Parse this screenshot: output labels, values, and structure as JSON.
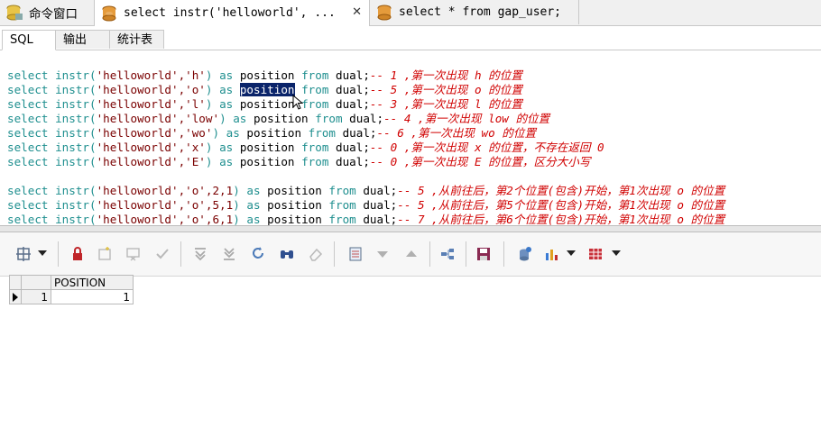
{
  "doc_tabs": [
    {
      "label": "命令窗口"
    },
    {
      "label": "select instr('helloworld', ..."
    },
    {
      "label": "select * from gap_user;"
    }
  ],
  "sub_tabs": [
    {
      "label": "SQL"
    },
    {
      "label": "输出"
    },
    {
      "label": "统计表"
    }
  ],
  "code_lines": [
    {
      "fn": "select instr(",
      "str": "'helloworld','h'",
      "as": ") as ",
      "col": "position",
      "from": " from ",
      "tbl": "dual;",
      "cmt": "-- 1 ,第一次出现 h 的位置"
    },
    {
      "fn": "select instr(",
      "str": "'helloworld','o'",
      "as": ") as ",
      "col": "position",
      "from": " from ",
      "tbl": "dual;",
      "cmt": "-- 5 ,第一次出现 o 的位置"
    },
    {
      "fn": "select instr(",
      "str": "'helloworld','l'",
      "as": ") as ",
      "col": "position",
      "from": " from ",
      "tbl": "dual;",
      "cmt": "-- 3 ,第一次出现 l 的位置"
    },
    {
      "fn": "select instr(",
      "str": "'helloworld','low'",
      "as": ") as ",
      "col": "position",
      "from": " from ",
      "tbl": "dual;",
      "cmt": "-- 4 ,第一次出现 low 的位置"
    },
    {
      "fn": "select instr(",
      "str": "'helloworld','wo'",
      "as": ") as ",
      "col": "position",
      "from": " from ",
      "tbl": "dual;",
      "cmt": "-- 6 ,第一次出现 wo 的位置"
    },
    {
      "fn": "select instr(",
      "str": "'helloworld','x'",
      "as": ") as ",
      "col": "position",
      "from": " from ",
      "tbl": "dual;",
      "cmt": "-- 0 ,第一次出现 x 的位置，不存在返回 0"
    },
    {
      "fn": "select instr(",
      "str": "'helloworld','E'",
      "as": ") as ",
      "col": "position",
      "from": " from ",
      "tbl": "dual;",
      "cmt": "-- 0 ,第一次出现 E 的位置，区分大小写"
    },
    {
      "blank": true
    },
    {
      "fn": "select instr(",
      "str": "'helloworld','o',2,1",
      "as": ") as ",
      "col": "position",
      "from": " from ",
      "tbl": "dual;",
      "cmt": "-- 5 ,从前往后，第2个位置(包含)开始，第1次出现 o 的位置"
    },
    {
      "fn": "select instr(",
      "str": "'helloworld','o',5,1",
      "as": ") as ",
      "col": "position",
      "from": " from ",
      "tbl": "dual;",
      "cmt": "-- 5 ,从前往后，第5个位置(包含)开始，第1次出现 o 的位置"
    },
    {
      "fn": "select instr(",
      "str": "'helloworld','o',6,1",
      "as": ") as ",
      "col": "position",
      "from": " from ",
      "tbl": "dual;",
      "cmt": "-- 7 ,从前往后，第6个位置(包含)开始，第1次出现 o 的位置"
    }
  ],
  "selected_line": 1,
  "toolbar_icons": [
    "grid-layout-icon",
    "lock-icon",
    "new-record-icon",
    "delete-record-icon",
    "post-check-icon",
    "first-record-icon",
    "last-record-icon",
    "refresh-icon",
    "find-icon",
    "clear-icon",
    "export-icon",
    "move-down-icon",
    "move-up-icon",
    "query-by-example-icon",
    "save-icon",
    "connect-icon",
    "chart-icon",
    "table-icon"
  ],
  "grid": {
    "columns": [
      "POSITION"
    ],
    "rows": [
      {
        "row_number": "1",
        "values": [
          "1"
        ]
      }
    ]
  },
  "colors": {
    "keyword": "#1f8f8f",
    "string": "#7a0000",
    "comment": "#d00000",
    "selection": "#0a246a"
  }
}
